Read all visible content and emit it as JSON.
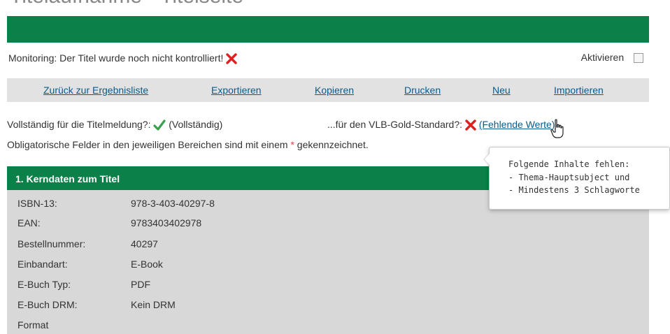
{
  "top_cut_text": "Titelaufnahme - Titelseite",
  "monitoring": {
    "text": "Monitoring: Der Titel wurde noch nicht kontrolliert!",
    "activate_label": "Aktivieren"
  },
  "nav": {
    "items": [
      {
        "label": "Zurück zur Ergebnisliste"
      },
      {
        "label": "Exportieren"
      },
      {
        "label": "Kopieren"
      },
      {
        "label": "Drucken"
      },
      {
        "label": "Neu"
      },
      {
        "label": "Importieren"
      }
    ]
  },
  "status": {
    "complete_label": "Vollständig für die Titelmeldung?:",
    "complete_value": "(Vollständig)",
    "vlb_label": "...für den VLB-Gold-Standard?:",
    "vlb_value": "(Fehlende Werte)"
  },
  "obligatory": {
    "text_before": "Obligatorische Felder in den jeweiligen Bereichen sind mit einem",
    "asterisk": "*",
    "text_after": "gekennzeichnet."
  },
  "section": {
    "title": "1. Kerndaten zum Titel",
    "rows": [
      {
        "label": "ISBN-13:",
        "value": "978-3-403-40297-8"
      },
      {
        "label": "EAN:",
        "value": "9783403402978"
      },
      {
        "label": "Bestellnummer:",
        "value": "40297"
      },
      {
        "label": "Einbandart:",
        "value": "E-Book"
      },
      {
        "label": "E-Buch Typ:",
        "value": "PDF"
      },
      {
        "label": "E-Buch DRM:",
        "value": "Kein DRM"
      },
      {
        "label": "Format",
        "value": ""
      }
    ]
  },
  "tooltip": {
    "title": "Folgende Inhalte fehlen:",
    "items": [
      "- Thema-Hauptsubject und",
      "- Mindestens 3 Schlagworte"
    ]
  },
  "colors": {
    "green": "#0b8048",
    "link": "#0a5b8a",
    "error_red": "#e02020",
    "check_green": "#3aa04a"
  }
}
